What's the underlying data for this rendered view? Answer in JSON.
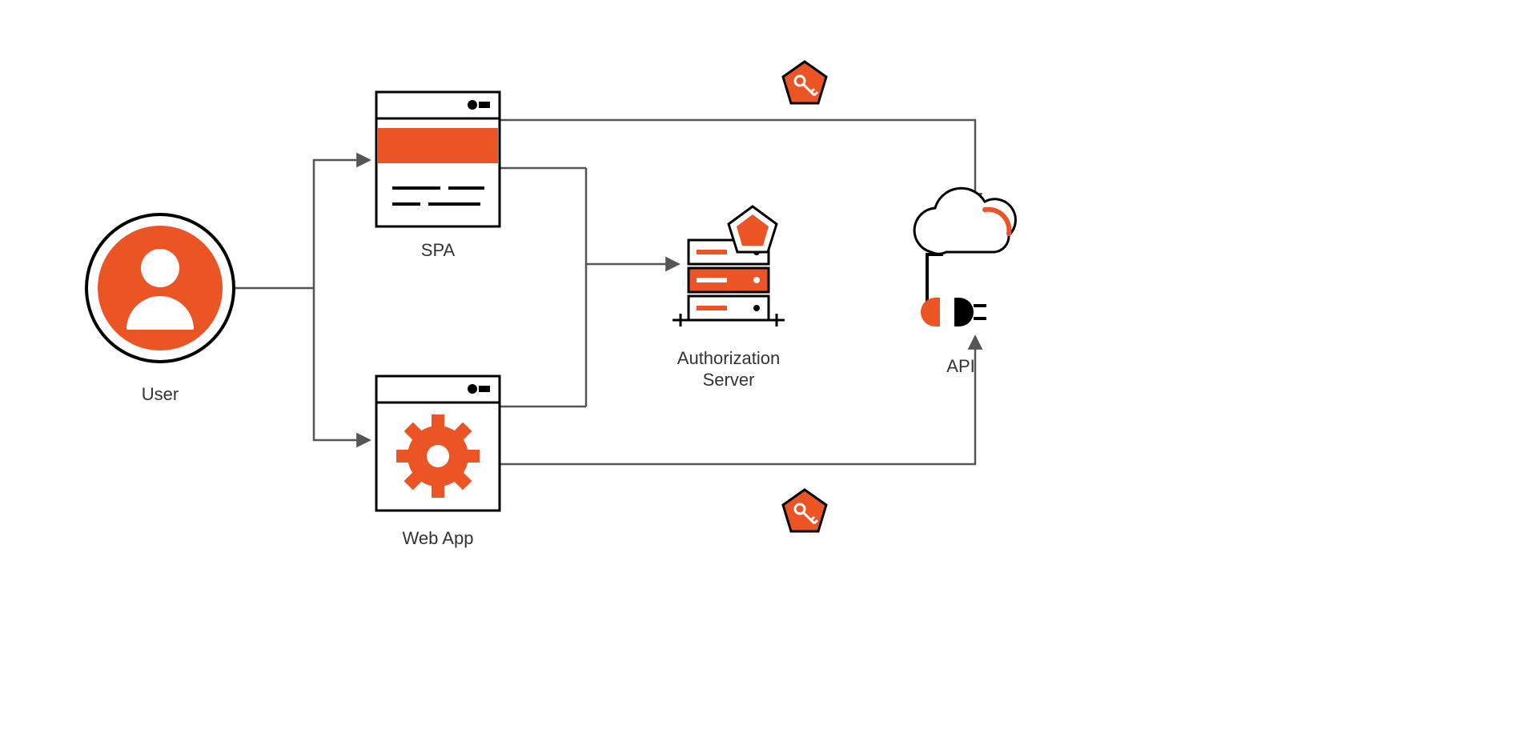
{
  "nodes": {
    "user": {
      "label": "User"
    },
    "spa": {
      "label": "SPA"
    },
    "webapp": {
      "label": "Web App"
    },
    "auth": {
      "label_line1": "Authorization",
      "label_line2": "Server"
    },
    "api": {
      "label": "API"
    }
  },
  "colors": {
    "accent": "#EB5424",
    "stroke": "#555555",
    "black": "#000000",
    "white": "#ffffff"
  }
}
